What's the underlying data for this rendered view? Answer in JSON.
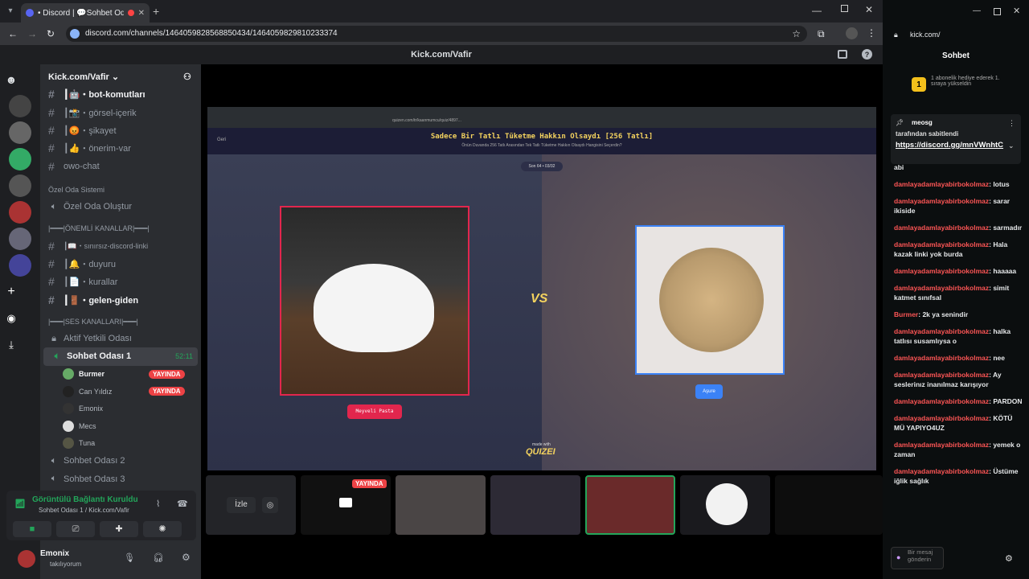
{
  "browser": {
    "tab_title": "• Discord | 💬Sohbet Oda",
    "url": "discord.com/channels/1464059828568850434/1464059829810233374"
  },
  "discord": {
    "window_title": "Kick.com/Vafir",
    "server_name": "Kick.com/Vafir",
    "channels": [
      {
        "label": "┃🤖・bot-komutları",
        "hash": "#"
      },
      {
        "label": "┃📸・görsel-içerik",
        "hash": "#"
      },
      {
        "label": "┃😡・şikayet",
        "hash": "#"
      },
      {
        "label": "┃👍・önerim-var",
        "hash": "#"
      },
      {
        "label": "owo-chat",
        "hash": "#"
      }
    ],
    "cat_private": "Özel Oda Sistemi",
    "create_room": "Özel Oda Oluştur",
    "cat_important": "|━━━|ÖNEMLİ KANALLAR|━━━|",
    "channels2": [
      {
        "label": "┃📖・sınırsız-discord-linki",
        "hash": "#"
      },
      {
        "label": "┃🔔・duyuru",
        "hash": "#"
      },
      {
        "label": "┃📄・kurallar",
        "hash": "#"
      },
      {
        "label": "┃🚪・gelen-giden",
        "hash": "#"
      }
    ],
    "cat_voice": "|━━━|SES KANALLARI|━━━|",
    "voice_locked": "Aktif Yetkili Odası",
    "voice_active": "Sohbet Odası 1",
    "voice_timer": "52:11",
    "users": [
      {
        "name": "Burmer",
        "live": "YAYINDA"
      },
      {
        "name": "Can Yıldız",
        "live": "YAYINDA"
      },
      {
        "name": "Emonix",
        "live": ""
      },
      {
        "name": "Mecs",
        "live": ""
      },
      {
        "name": "Tuna",
        "live": ""
      }
    ],
    "voice2": "Sohbet Odası 2",
    "voice3": "Sohbet Odası 3",
    "conn_status": "Görüntülü Bağlantı Kuruldu",
    "conn_sub": "Sohbet Odası 1 / Kick.com/Vafir",
    "me_name": "Emonix",
    "me_status": "takılıyorum"
  },
  "quiz": {
    "url": "quizen.com/tr/kaanmumcu/quiz/4897...",
    "back": "Geri",
    "title": "Sadece Bir Tatlı Tüketme Hakkın Olsaydı [256 Tatlı]",
    "subtitle": "Önün Duvanda 256 Tatlı Arasından Tek Tatlı Tüketme Hakkın Olsaydı Hangisini Seçerdin?",
    "round": "Son 64 • 03/32",
    "left_label": "Meyveli Pasta",
    "right_label": "Aşure",
    "vs": "VS",
    "made_with": "made with",
    "brand": "QUIZEI"
  },
  "stream_bar": {
    "watch": "İzle",
    "live": "YAYINDA"
  },
  "chat": {
    "url": "kick.com/",
    "header": "Sohbet",
    "gift_text": "1 abonelik hediye ederek 1. sıraya yükseldin",
    "pin_user": "meosg",
    "pin_by": "tarafından sabitlendi",
    "pin_link": "https://discord.gg/mnVWnhtC",
    "messages": [
      {
        "user": "",
        "text": "abi"
      },
      {
        "user": "damlayadamlayabirbokolmaz",
        "text": "lotus"
      },
      {
        "user": "damlayadamlayabirbokolmaz",
        "text": "sarar ikiside"
      },
      {
        "user": "damlayadamlayabirbokolmaz",
        "text": "sarmadır"
      },
      {
        "user": "damlayadamlayabirbokolmaz",
        "text": "Hala kazak linki yok burda"
      },
      {
        "user": "damlayadamlayabirbokolmaz",
        "text": "haaaaa"
      },
      {
        "user": "damlayadamlayabirbokolmaz",
        "text": "simit katmet sınıfsal"
      },
      {
        "user": "Burmer",
        "text": "2k ya senindir"
      },
      {
        "user": "damlayadamlayabirbokolmaz",
        "text": "halka tatlısı susamlıysa o"
      },
      {
        "user": "damlayadamlayabirbokolmaz",
        "text": "nee"
      },
      {
        "user": "damlayadamlayabirbokolmaz",
        "text": "Ay seslerinız inanılmaz karışıyor"
      },
      {
        "user": "damlayadamlayabirbokolmaz",
        "text": "PARDON"
      },
      {
        "user": "damlayadamlayabirbokolmaz",
        "text": "KÖTÜ MÜ YAPIYO4UZ"
      },
      {
        "user": "damlayadamlayabirbokolmaz",
        "text": "yemek o zaman"
      },
      {
        "user": "damlayadamlayabirbokolmaz",
        "text": "Üstüme iğlik sağlık"
      }
    ],
    "input_placeholder": "Bir mesaj gönderin"
  }
}
